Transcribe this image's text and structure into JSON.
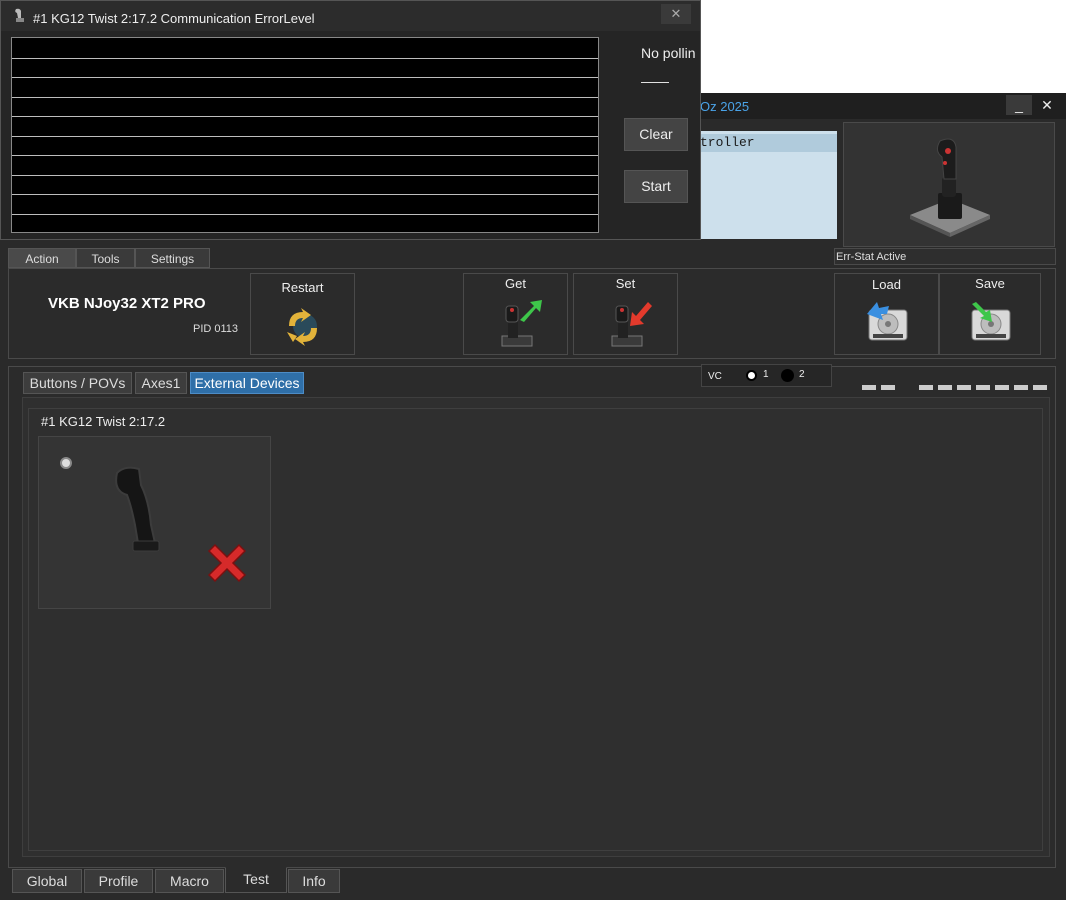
{
  "main_window": {
    "title_fragment": "Oz 2025",
    "minimize_label": "_",
    "close_label": "✕",
    "device_list": {
      "items": [
        "troller"
      ]
    },
    "err_stat": "Err-Stat Active",
    "top_tabs": [
      "Action",
      "Tools",
      "Settings"
    ],
    "action_panel": {
      "device_name": "VKB NJoy32 XT2 PRO",
      "pid": "PID 0113",
      "restart_label": "Restart",
      "get_label": "Get",
      "set_label": "Set",
      "load_label": "Load",
      "save_label": "Save"
    },
    "sub_tabs": [
      "Buttons / POVs",
      "Axes1",
      "External Devices"
    ],
    "active_sub_tab": "External Devices",
    "vc": {
      "label": "VC",
      "option1": "1",
      "option2": "2"
    },
    "external_group_title": "#1 KG12 Twist 2:17.2",
    "bottom_tabs": [
      "Global",
      "Profile",
      "Macro",
      "Test",
      "Info"
    ],
    "active_bottom_tab": "Test"
  },
  "error_window": {
    "title": "#1 KG12 Twist  2:17.2  Communication ErrorLevel",
    "close_label": "✕",
    "status_text": "No polling",
    "status_value": "——",
    "clear_label": "Clear",
    "start_label": "Start",
    "log_rows": 10
  },
  "colors": {
    "title_accent": "#4aa3e8",
    "active_tab": "#2f6fa8",
    "error_x": "#d62a2a",
    "arrow_green": "#3ec64a",
    "arrow_red": "#e33a2c",
    "arrow_blue": "#3a8fe0"
  },
  "icons": [
    "joystick-icon",
    "recycle-icon",
    "get-arrow-icon",
    "set-arrow-icon",
    "load-disk-icon",
    "save-disk-icon",
    "remove-x-icon"
  ]
}
